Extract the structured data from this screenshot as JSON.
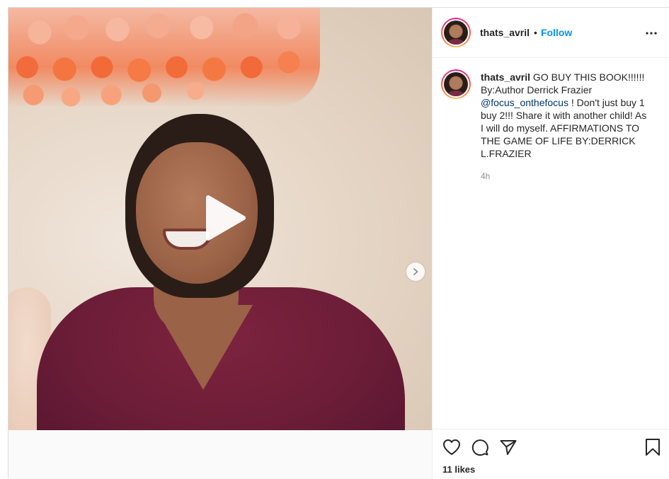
{
  "post": {
    "username": "thats_avril",
    "separator": "•",
    "follow_label": "Follow",
    "more_icon": "more-horizontal-icon",
    "media": {
      "type": "video",
      "play_icon": "play-icon",
      "next_icon": "chevron-right-icon"
    },
    "caption": {
      "username": "thats_avril",
      "text_part1": " GO BUY THIS BOOK!!!!!! By:Author Derrick Frazier ",
      "mention": "@focus_onthefocus",
      "text_part2": " ! Don't just buy 1 buy 2!!! Share it with another child! As I will do myself. AFFIRMATIONS TO THE GAME OF LIFE BY:DERRICK L.FRAZIER",
      "time": "4h"
    },
    "actions": {
      "like_icon": "heart-icon",
      "comment_icon": "comment-icon",
      "share_icon": "send-icon",
      "save_icon": "bookmark-icon"
    },
    "likes": "11 likes"
  },
  "colors": {
    "link_blue": "#0095f6",
    "mention_blue": "#00376b",
    "text": "#262626",
    "muted": "#8e8e8e",
    "border": "#dbdbdb"
  }
}
